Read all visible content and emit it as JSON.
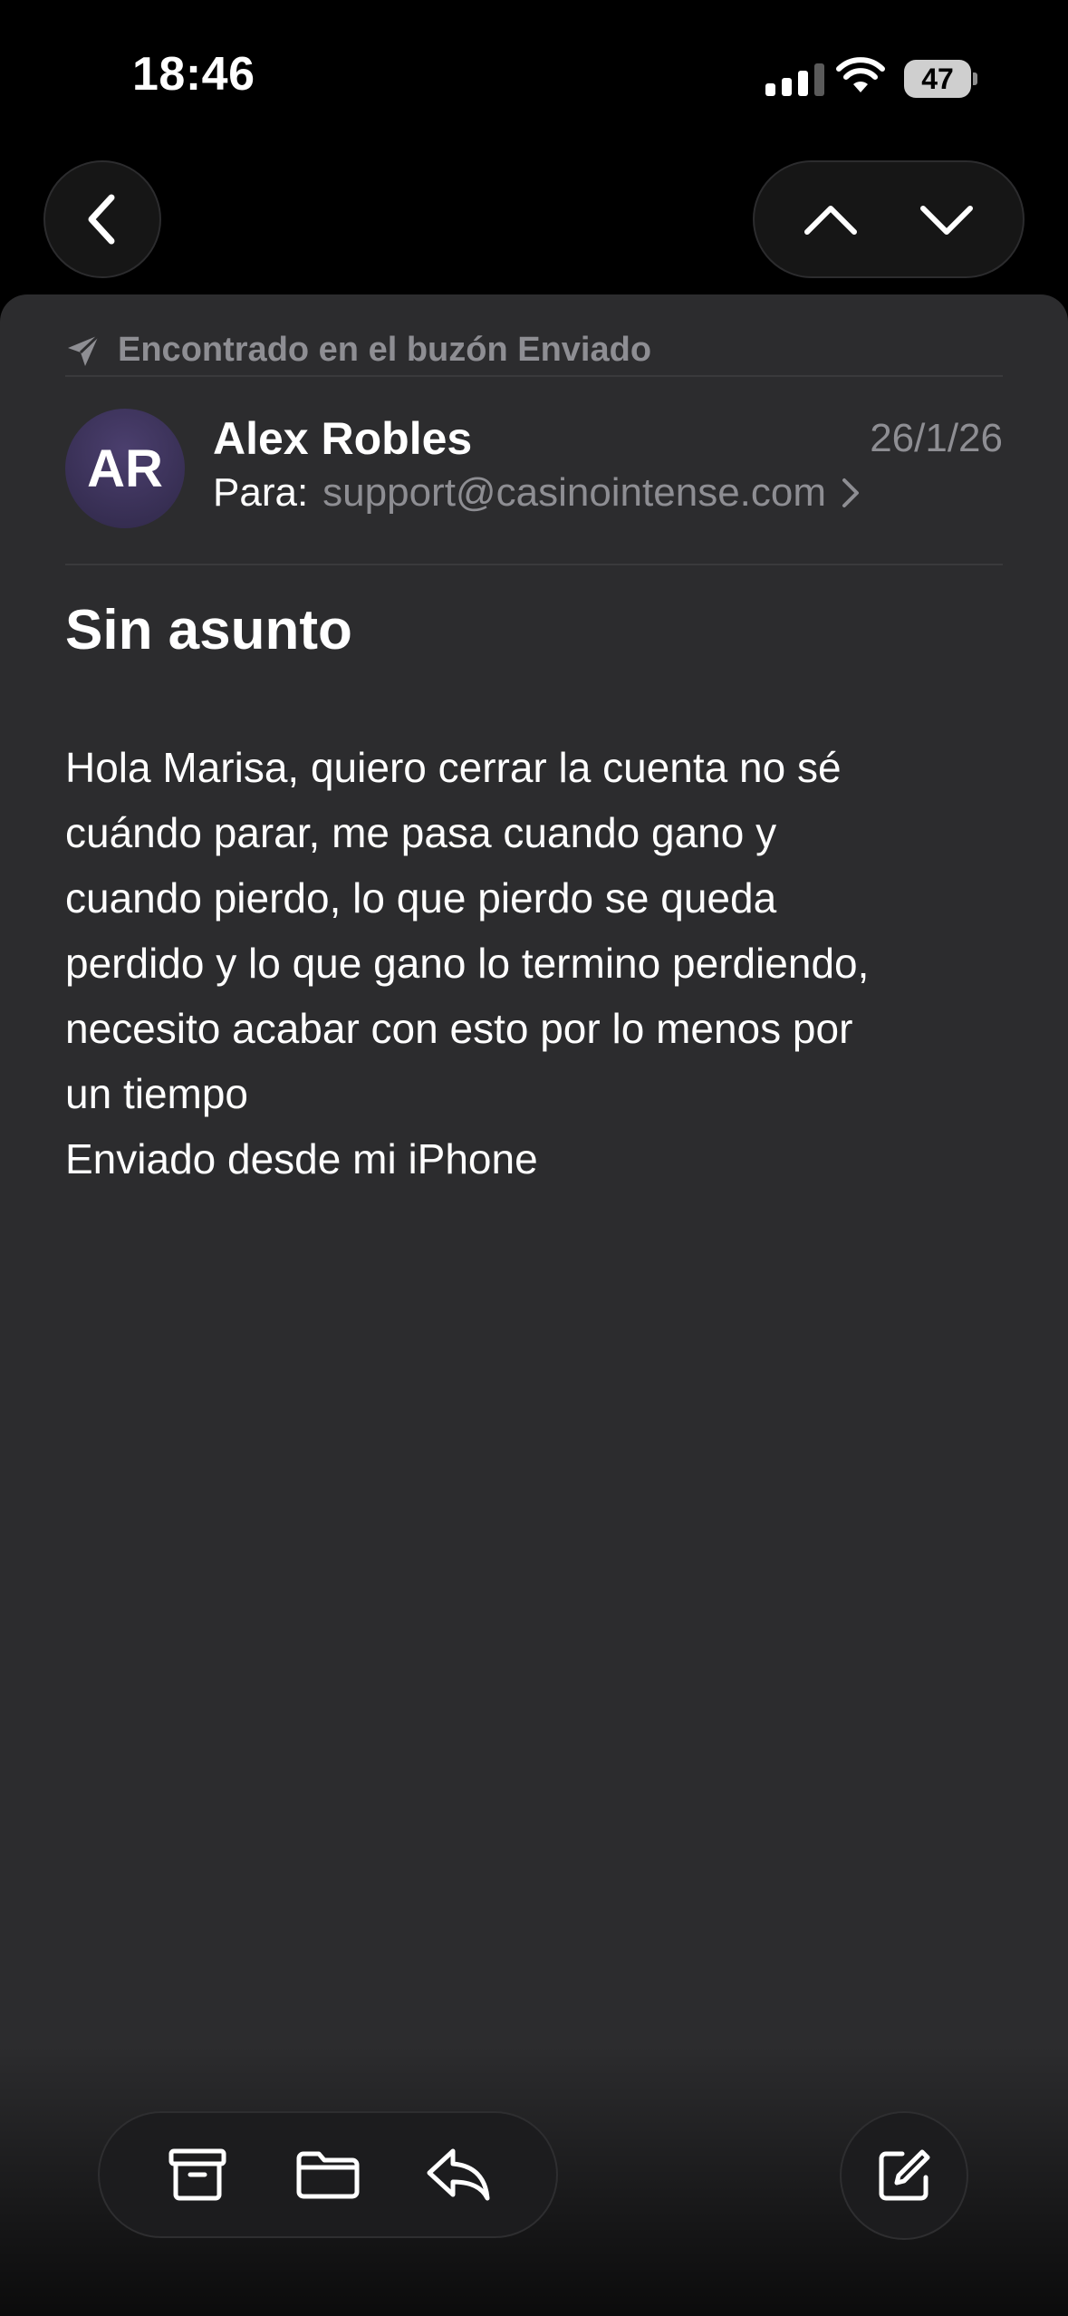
{
  "status_bar": {
    "time": "18:46",
    "battery": "47"
  },
  "nav": {
    "back_icon": "chevron-left-icon",
    "prev_icon": "chevron-up-icon",
    "next_icon": "chevron-down-icon"
  },
  "message": {
    "found_in": "Encontrado en el buzón Enviado",
    "sender_initials": "AR",
    "sender_name": "Alex Robles",
    "date": "26/1/26",
    "to_label": "Para:",
    "to_address": "support@casinointense.com",
    "subject": "Sin asunto",
    "body_lines": [
      "Hola Marisa, quiero cerrar la cuenta no sé",
      "cuándo parar, me pasa cuando gano y",
      "cuando pierdo, lo que pierdo se queda",
      "perdido y lo que gano lo termino perdiendo,",
      "necesito acabar con esto por lo menos por",
      "un tiempo",
      "Enviado desde mi iPhone"
    ]
  },
  "toolbar": {
    "archive_icon": "archive-icon",
    "move_icon": "folder-icon",
    "reply_icon": "reply-icon",
    "compose_icon": "compose-icon"
  },
  "colors": {
    "background": "#000000",
    "sheet": "#2c2c2e",
    "secondary_text": "#8e8e93",
    "avatar": "#3a3157"
  }
}
